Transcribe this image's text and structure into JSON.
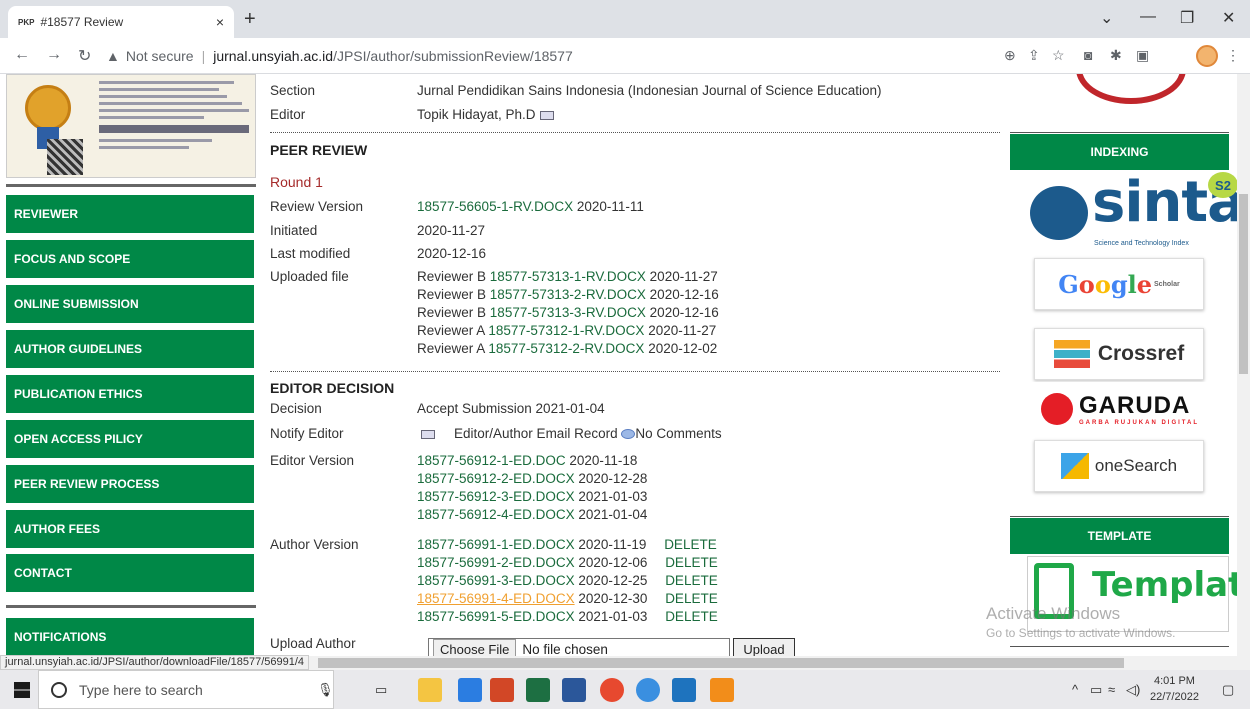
{
  "browser": {
    "tab_favicon": "PKP",
    "tab_title": "#18577 Review",
    "tab_close": "×",
    "new_tab": "+",
    "not_secure": "Not secure",
    "url_host": "jurnal.unsyiah.ac.id",
    "url_path": "/JPSI/author/submissionReview/18577",
    "status_url": "jurnal.unsyiah.ac.id/JPSI/author/downloadFile/18577/56991/4"
  },
  "sidebar": {
    "items": [
      {
        "label": "REVIEWER"
      },
      {
        "label": "FOCUS AND SCOPE"
      },
      {
        "label": "ONLINE SUBMISSION"
      },
      {
        "label": "AUTHOR GUIDELINES"
      },
      {
        "label": "PUBLICATION ETHICS"
      },
      {
        "label": "OPEN ACCESS PILICY"
      },
      {
        "label": "PEER REVIEW PROCESS"
      },
      {
        "label": "AUTHOR FEES"
      },
      {
        "label": "CONTACT"
      },
      {
        "label": "NOTIFICATIONS"
      }
    ]
  },
  "submission": {
    "section_label": "Section",
    "section_value": "Jurnal Pendidikan Sains Indonesia (Indonesian Journal of Science Education)",
    "editor_label": "Editor",
    "editor_value": "Topik Hidayat, Ph.D"
  },
  "peer_review": {
    "title": "PEER REVIEW",
    "round": "Round 1",
    "review_version_label": "Review Version",
    "review_version_file": "18577-56605-1-RV.DOCX",
    "review_version_date": "2020-11-11",
    "initiated_label": "Initiated",
    "initiated_value": "2020-11-27",
    "last_modified_label": "Last modified",
    "last_modified_value": "2020-12-16",
    "uploaded_label": "Uploaded file",
    "uploads": [
      {
        "reviewer": "Reviewer B",
        "file": "18577-57313-1-RV.DOCX",
        "date": "2020-11-27"
      },
      {
        "reviewer": "Reviewer B",
        "file": "18577-57313-2-RV.DOCX",
        "date": "2020-12-16"
      },
      {
        "reviewer": "Reviewer B",
        "file": "18577-57313-3-RV.DOCX",
        "date": "2020-12-16"
      },
      {
        "reviewer": "Reviewer A",
        "file": "18577-57312-1-RV.DOCX",
        "date": "2020-11-27"
      },
      {
        "reviewer": "Reviewer A",
        "file": "18577-57312-2-RV.DOCX",
        "date": "2020-12-02"
      }
    ]
  },
  "editor_decision": {
    "title": "EDITOR DECISION",
    "decision_label": "Decision",
    "decision_value": "Accept Submission 2021-01-04",
    "notify_label": "Notify Editor",
    "notify_record": "Editor/Author Email Record",
    "notify_comments": "No Comments",
    "editor_version_label": "Editor Version",
    "editor_versions": [
      {
        "file": "18577-56912-1-ED.DOC",
        "date": "2020-11-18"
      },
      {
        "file": "18577-56912-2-ED.DOCX",
        "date": "2020-12-28"
      },
      {
        "file": "18577-56912-3-ED.DOCX",
        "date": "2021-01-03"
      },
      {
        "file": "18577-56912-4-ED.DOCX",
        "date": "2021-01-04"
      }
    ],
    "author_version_label": "Author Version",
    "author_versions": [
      {
        "file": "18577-56991-1-ED.DOCX",
        "date": "2020-11-19",
        "action": "DELETE"
      },
      {
        "file": "18577-56991-2-ED.DOCX",
        "date": "2020-12-06",
        "action": "DELETE"
      },
      {
        "file": "18577-56991-3-ED.DOCX",
        "date": "2020-12-25",
        "action": "DELETE"
      },
      {
        "file": "18577-56991-4-ED.DOCX",
        "date": "2020-12-30",
        "action": "DELETE"
      },
      {
        "file": "18577-56991-5-ED.DOCX",
        "date": "2021-01-03",
        "action": "DELETE"
      }
    ],
    "upload_label": "Upload Author",
    "choose_file": "Choose File",
    "no_file": "No file chosen",
    "upload_button": "Upload"
  },
  "right": {
    "indexing_title": "INDEXING",
    "sinta_text": "sinta",
    "sinta_badge": "S2",
    "sinta_sub": "Science and Technology Index",
    "google_text": "Google",
    "google_sub": "Scholar",
    "crossref_text": "Crossref",
    "garuda_text": "GARUDA",
    "garuda_sub": "GARBA RUJUKAN DIGITAL",
    "onesearch_text": "oneSearch",
    "template_title": "TEMPLATE",
    "template_text": "Template"
  },
  "watermark": {
    "line1": "Activate Windows",
    "line2": "Go to Settings to activate Windows."
  },
  "taskbar": {
    "search_placeholder": "Type here to search",
    "time": "4:01 PM",
    "date": "22/7/2022"
  }
}
